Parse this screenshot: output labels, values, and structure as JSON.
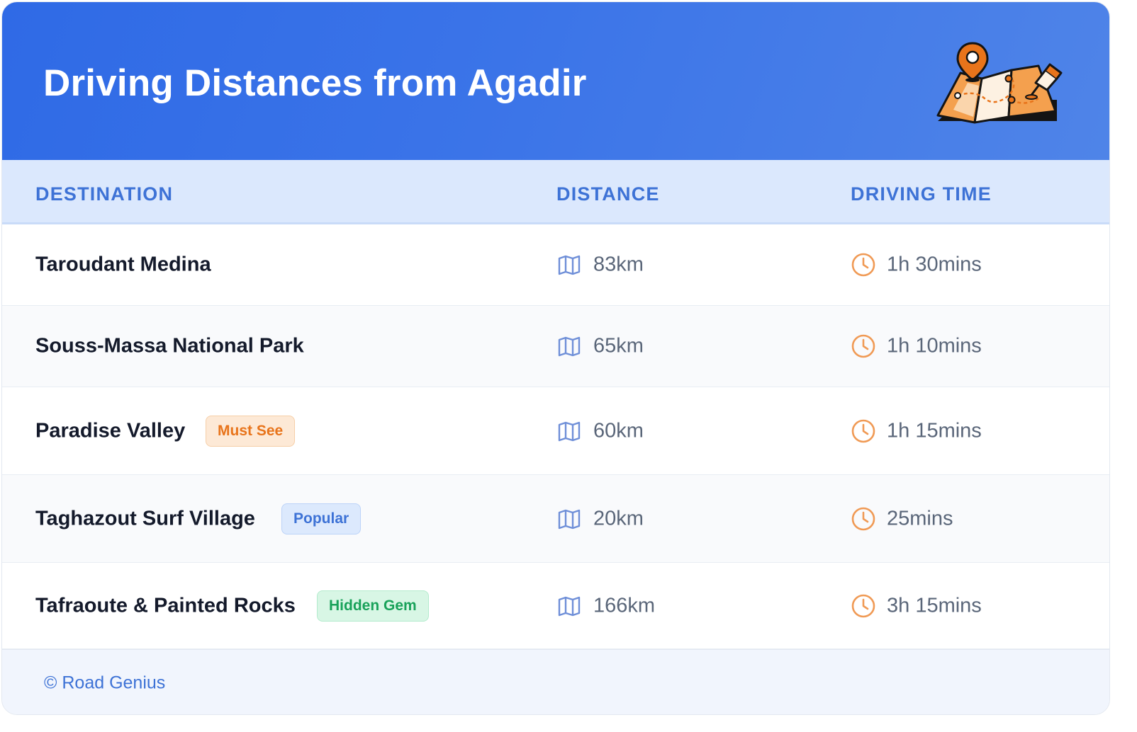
{
  "header": {
    "title": "Driving Distances from Agadir",
    "illustration_icon": "folded-map-with-pins-icon"
  },
  "table": {
    "columns": [
      "DESTINATION",
      "DISTANCE",
      "DRIVING TIME"
    ],
    "rows": [
      {
        "destination": "Taroudant Medina",
        "badge": "",
        "badge_color": "",
        "distance": "83km",
        "time": "1h 30mins"
      },
      {
        "destination": "Souss-Massa National Park",
        "badge": "",
        "badge_color": "",
        "distance": "65km",
        "time": "1h 10mins"
      },
      {
        "destination": "Paradise Valley",
        "badge": "Must See",
        "badge_color": "orange",
        "distance": "60km",
        "time": "1h 15mins"
      },
      {
        "destination": "Taghazout Surf Village",
        "badge": "Popular",
        "badge_color": "blue",
        "distance": "20km",
        "time": "25mins"
      },
      {
        "destination": "Tafraoute & Painted Rocks",
        "badge": "Hidden Gem",
        "badge_color": "green",
        "distance": "166km",
        "time": "3h 15mins"
      }
    ]
  },
  "icons": {
    "distance": "map-icon",
    "time": "clock-icon"
  },
  "footer": {
    "copyright": "© Road Genius"
  },
  "colors": {
    "header_bg": "#2f6ae6",
    "accent_blue": "#3d72d6",
    "accent_orange": "#e8741b",
    "accent_green": "#19a25a"
  }
}
